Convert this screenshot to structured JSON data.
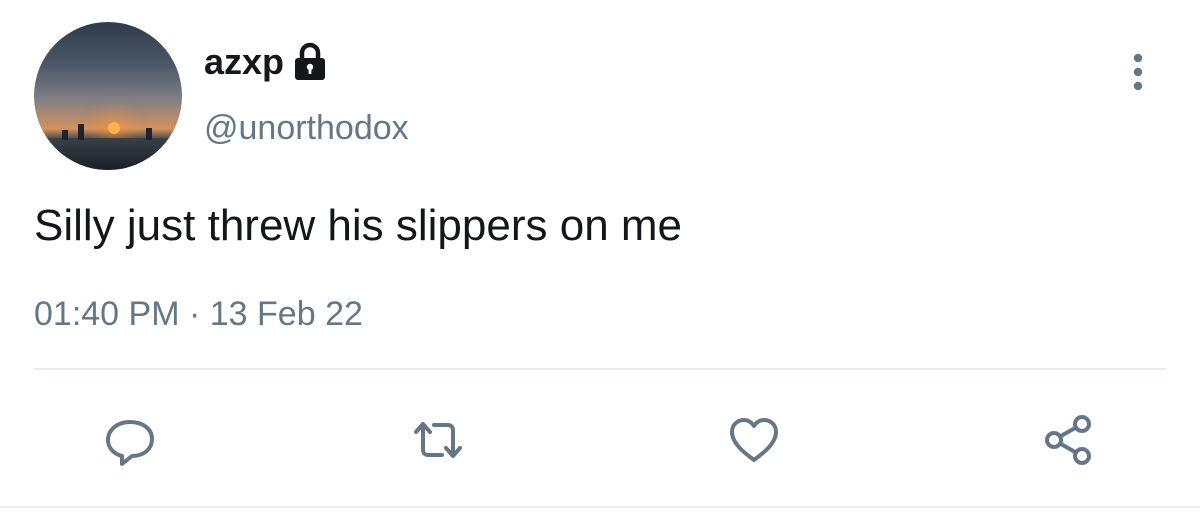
{
  "tweet": {
    "display_name": "azxp",
    "handle": "@unorthodox",
    "text": "Silly just threw his slippers on me",
    "time": "01:40 PM",
    "separator": "·",
    "date": "13 Feb 22"
  },
  "icons": {
    "lock": "lock-icon",
    "more": "more-vertical-icon",
    "reply": "reply-icon",
    "retweet": "retweet-icon",
    "like": "heart-icon",
    "share": "share-icon"
  },
  "colors": {
    "text": "#14171a",
    "secondary": "#657786",
    "divider": "#e6ecf0"
  }
}
